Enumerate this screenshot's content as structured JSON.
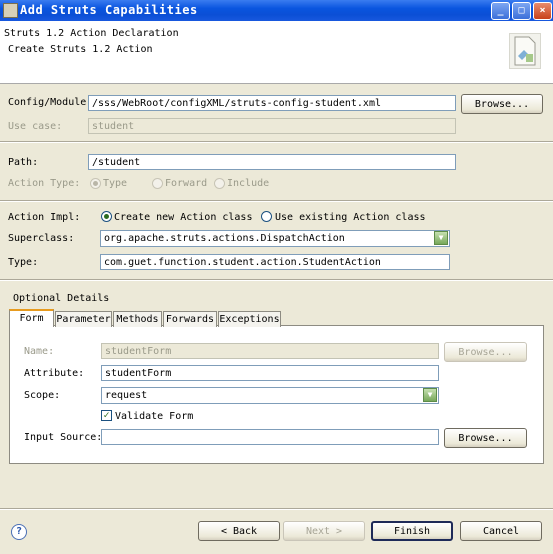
{
  "window": {
    "title": "Add Struts Capabilities",
    "title_icon": "app-icon",
    "minimize": "_",
    "maximize": "□",
    "close": "×"
  },
  "header": {
    "title": "Struts 1.2 Action Declaration",
    "subtitle": "Create Struts 1.2 Action",
    "icon": "wizard-document-icon"
  },
  "config": {
    "module_label": "Config/Module:",
    "module_value": "/sss/WebRoot/configXML/struts-config-student.xml",
    "browse_label": "Browse...",
    "usecase_label": "Use case:",
    "usecase_value": "student"
  },
  "path": {
    "label": "Path:",
    "value": "/student",
    "action_type_label": "Action Type:",
    "types": [
      "Type",
      "Forward",
      "Include"
    ]
  },
  "impl": {
    "label": "Action Impl:",
    "option_create": "Create new Action class",
    "option_existing": "Use existing Action class",
    "superclass_label": "Superclass:",
    "superclass_value": "org.apache.struts.actions.DispatchAction",
    "type_label": "Type:",
    "type_value": "com.guet.function.student.action.StudentAction"
  },
  "optional": {
    "group_label": "Optional Details",
    "tabs": [
      "Form",
      "Parameter",
      "Methods",
      "Forwards",
      "Exceptions"
    ],
    "form": {
      "name_label": "Name:",
      "name_value": "studentForm",
      "name_browse": "Browse...",
      "attribute_label": "Attribute:",
      "attribute_value": "studentForm",
      "scope_label": "Scope:",
      "scope_value": "request",
      "validate_label": "Validate Form",
      "input_label": "Input Source:",
      "input_value": "",
      "input_browse": "Browse..."
    }
  },
  "footer": {
    "help": "?",
    "back": "< Back",
    "next": "Next >",
    "finish": "Finish",
    "cancel": "Cancel"
  }
}
